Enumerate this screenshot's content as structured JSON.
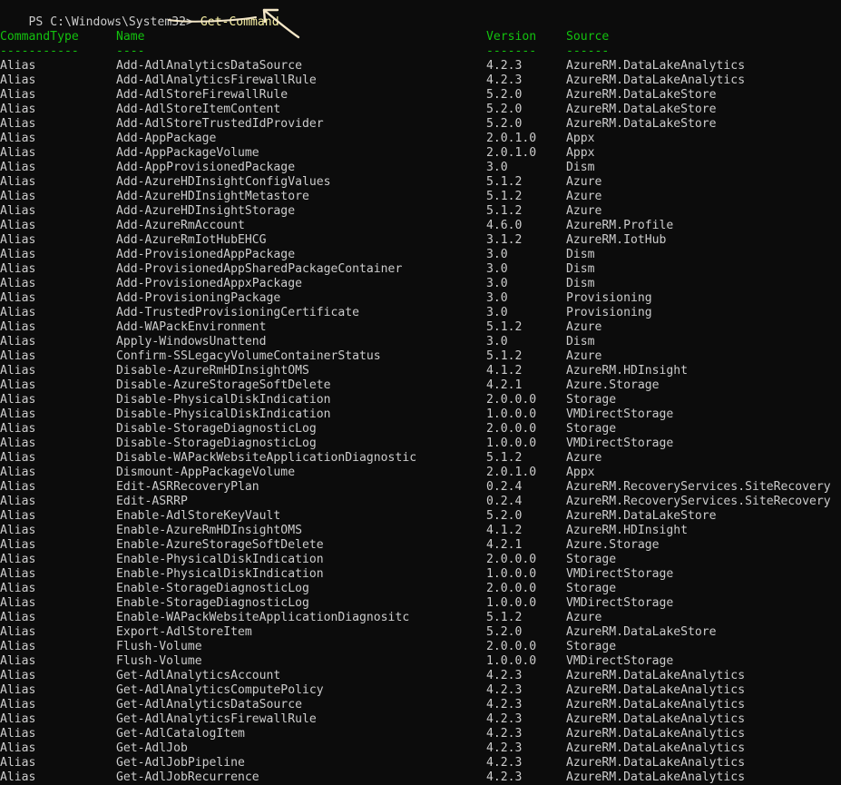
{
  "prompt": {
    "path": "PS C:\\Windows\\System32>",
    "command": "Get-Command"
  },
  "header": {
    "columns": [
      "CommandType",
      "Name",
      "Version",
      "Source"
    ],
    "dashes": [
      "-----------",
      "----",
      "-------",
      "------"
    ]
  },
  "rows": [
    [
      "Alias",
      "Add-AdlAnalyticsDataSource",
      "4.2.3",
      "AzureRM.DataLakeAnalytics"
    ],
    [
      "Alias",
      "Add-AdlAnalyticsFirewallRule",
      "4.2.3",
      "AzureRM.DataLakeAnalytics"
    ],
    [
      "Alias",
      "Add-AdlStoreFirewallRule",
      "5.2.0",
      "AzureRM.DataLakeStore"
    ],
    [
      "Alias",
      "Add-AdlStoreItemContent",
      "5.2.0",
      "AzureRM.DataLakeStore"
    ],
    [
      "Alias",
      "Add-AdlStoreTrustedIdProvider",
      "5.2.0",
      "AzureRM.DataLakeStore"
    ],
    [
      "Alias",
      "Add-AppPackage",
      "2.0.1.0",
      "Appx"
    ],
    [
      "Alias",
      "Add-AppPackageVolume",
      "2.0.1.0",
      "Appx"
    ],
    [
      "Alias",
      "Add-AppProvisionedPackage",
      "3.0",
      "Dism"
    ],
    [
      "Alias",
      "Add-AzureHDInsightConfigValues",
      "5.1.2",
      "Azure"
    ],
    [
      "Alias",
      "Add-AzureHDInsightMetastore",
      "5.1.2",
      "Azure"
    ],
    [
      "Alias",
      "Add-AzureHDInsightStorage",
      "5.1.2",
      "Azure"
    ],
    [
      "Alias",
      "Add-AzureRmAccount",
      "4.6.0",
      "AzureRM.Profile"
    ],
    [
      "Alias",
      "Add-AzureRmIotHubEHCG",
      "3.1.2",
      "AzureRM.IotHub"
    ],
    [
      "Alias",
      "Add-ProvisionedAppPackage",
      "3.0",
      "Dism"
    ],
    [
      "Alias",
      "Add-ProvisionedAppSharedPackageContainer",
      "3.0",
      "Dism"
    ],
    [
      "Alias",
      "Add-ProvisionedAppxPackage",
      "3.0",
      "Dism"
    ],
    [
      "Alias",
      "Add-ProvisioningPackage",
      "3.0",
      "Provisioning"
    ],
    [
      "Alias",
      "Add-TrustedProvisioningCertificate",
      "3.0",
      "Provisioning"
    ],
    [
      "Alias",
      "Add-WAPackEnvironment",
      "5.1.2",
      "Azure"
    ],
    [
      "Alias",
      "Apply-WindowsUnattend",
      "3.0",
      "Dism"
    ],
    [
      "Alias",
      "Confirm-SSLegacyVolumeContainerStatus",
      "5.1.2",
      "Azure"
    ],
    [
      "Alias",
      "Disable-AzureRmHDInsightOMS",
      "4.1.2",
      "AzureRM.HDInsight"
    ],
    [
      "Alias",
      "Disable-AzureStorageSoftDelete",
      "4.2.1",
      "Azure.Storage"
    ],
    [
      "Alias",
      "Disable-PhysicalDiskIndication",
      "2.0.0.0",
      "Storage"
    ],
    [
      "Alias",
      "Disable-PhysicalDiskIndication",
      "1.0.0.0",
      "VMDirectStorage"
    ],
    [
      "Alias",
      "Disable-StorageDiagnosticLog",
      "2.0.0.0",
      "Storage"
    ],
    [
      "Alias",
      "Disable-StorageDiagnosticLog",
      "1.0.0.0",
      "VMDirectStorage"
    ],
    [
      "Alias",
      "Disable-WAPackWebsiteApplicationDiagnostic",
      "5.1.2",
      "Azure"
    ],
    [
      "Alias",
      "Dismount-AppPackageVolume",
      "2.0.1.0",
      "Appx"
    ],
    [
      "Alias",
      "Edit-ASRRecoveryPlan",
      "0.2.4",
      "AzureRM.RecoveryServices.SiteRecovery"
    ],
    [
      "Alias",
      "Edit-ASRRP",
      "0.2.4",
      "AzureRM.RecoveryServices.SiteRecovery"
    ],
    [
      "Alias",
      "Enable-AdlStoreKeyVault",
      "5.2.0",
      "AzureRM.DataLakeStore"
    ],
    [
      "Alias",
      "Enable-AzureRmHDInsightOMS",
      "4.1.2",
      "AzureRM.HDInsight"
    ],
    [
      "Alias",
      "Enable-AzureStorageSoftDelete",
      "4.2.1",
      "Azure.Storage"
    ],
    [
      "Alias",
      "Enable-PhysicalDiskIndication",
      "2.0.0.0",
      "Storage"
    ],
    [
      "Alias",
      "Enable-PhysicalDiskIndication",
      "1.0.0.0",
      "VMDirectStorage"
    ],
    [
      "Alias",
      "Enable-StorageDiagnosticLog",
      "2.0.0.0",
      "Storage"
    ],
    [
      "Alias",
      "Enable-StorageDiagnosticLog",
      "1.0.0.0",
      "VMDirectStorage"
    ],
    [
      "Alias",
      "Enable-WAPackWebsiteApplicationDiagnositc",
      "5.1.2",
      "Azure"
    ],
    [
      "Alias",
      "Export-AdlStoreItem",
      "5.2.0",
      "AzureRM.DataLakeStore"
    ],
    [
      "Alias",
      "Flush-Volume",
      "2.0.0.0",
      "Storage"
    ],
    [
      "Alias",
      "Flush-Volume",
      "1.0.0.0",
      "VMDirectStorage"
    ],
    [
      "Alias",
      "Get-AdlAnalyticsAccount",
      "4.2.3",
      "AzureRM.DataLakeAnalytics"
    ],
    [
      "Alias",
      "Get-AdlAnalyticsComputePolicy",
      "4.2.3",
      "AzureRM.DataLakeAnalytics"
    ],
    [
      "Alias",
      "Get-AdlAnalyticsDataSource",
      "4.2.3",
      "AzureRM.DataLakeAnalytics"
    ],
    [
      "Alias",
      "Get-AdlAnalyticsFirewallRule",
      "4.2.3",
      "AzureRM.DataLakeAnalytics"
    ],
    [
      "Alias",
      "Get-AdlCatalogItem",
      "4.2.3",
      "AzureRM.DataLakeAnalytics"
    ],
    [
      "Alias",
      "Get-AdlJob",
      "4.2.3",
      "AzureRM.DataLakeAnalytics"
    ],
    [
      "Alias",
      "Get-AdlJobPipeline",
      "4.2.3",
      "AzureRM.DataLakeAnalytics"
    ],
    [
      "Alias",
      "Get-AdlJobRecurrence",
      "4.2.3",
      "AzureRM.DataLakeAnalytics"
    ]
  ],
  "colors": {
    "background": "#0c0c0c",
    "text": "#cccccc",
    "command": "#f9f1a5",
    "header": "#13c20e",
    "annotation": "#f4e7c8"
  }
}
